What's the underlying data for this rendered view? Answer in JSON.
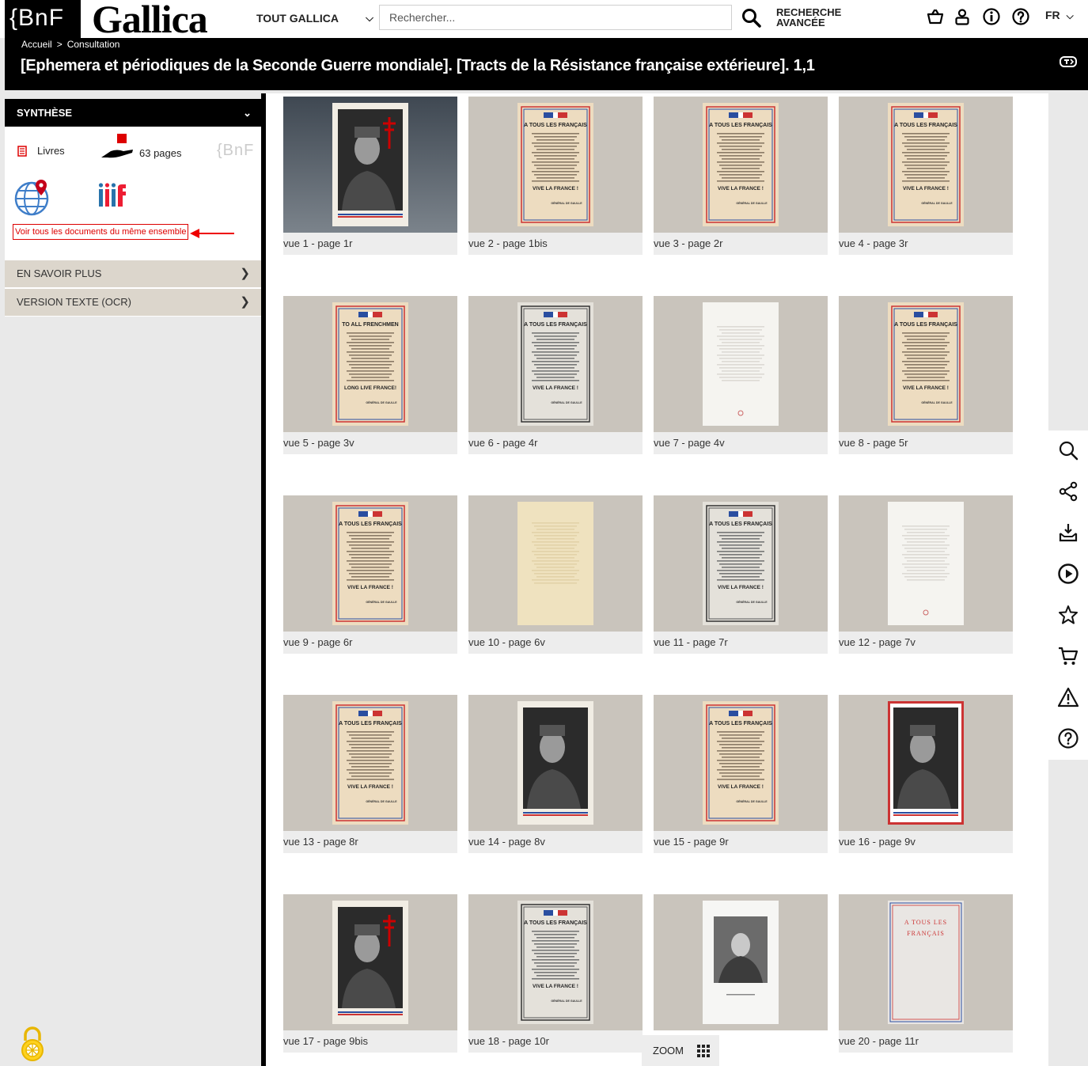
{
  "header": {
    "bnf_logo": "{BnF",
    "gallica_logo": "Gallica",
    "scope": "TOUT GALLICA",
    "search_placeholder": "Rechercher...",
    "advanced_line1": "RECHERCHE",
    "advanced_line2": "AVANCÉE",
    "lang": "FR",
    "icons": [
      "basket-icon",
      "account-icon",
      "info-icon",
      "help-icon"
    ]
  },
  "breadcrumb": {
    "home": "Accueil",
    "sep": ">",
    "current": "Consultation"
  },
  "title": "[Ephemera et périodiques de la Seconde Guerre mondiale]. [Tracts de la Résistance française extérieure]. 1,1",
  "sidebar": {
    "header": "SYNTHÈSE",
    "doc_type": "Livres",
    "pages": "63 pages",
    "watermark": "{BnF",
    "same_set_link": "Voir tous les documents du même ensemble",
    "panels": [
      {
        "label": "EN SAVOIR PLUS"
      },
      {
        "label": "VERSION TEXTE (OCR)"
      }
    ]
  },
  "thumbnails": [
    {
      "caption": "vue 1 - page 1r",
      "kind": "portrait-cross",
      "dark": true
    },
    {
      "caption": "vue 2 - page 1bis",
      "kind": "poster"
    },
    {
      "caption": "vue 3 - page 2r",
      "kind": "poster"
    },
    {
      "caption": "vue 4 - page 3r",
      "kind": "poster"
    },
    {
      "caption": "vue 5 - page 3v",
      "kind": "poster-en"
    },
    {
      "caption": "vue 6 - page 4r",
      "kind": "poster-bw"
    },
    {
      "caption": "vue 7 - page 4v",
      "kind": "blank"
    },
    {
      "caption": "vue 8 - page 5r",
      "kind": "poster"
    },
    {
      "caption": "vue 9 - page 6r",
      "kind": "poster"
    },
    {
      "caption": "vue 10 - page 6v",
      "kind": "faded"
    },
    {
      "caption": "vue 11 - page 7r",
      "kind": "poster-bw"
    },
    {
      "caption": "vue 12 - page 7v",
      "kind": "blank"
    },
    {
      "caption": "vue 13 - page 8r",
      "kind": "poster"
    },
    {
      "caption": "vue 14 - page 8v",
      "kind": "portrait"
    },
    {
      "caption": "vue 15 - page 9r",
      "kind": "poster"
    },
    {
      "caption": "vue 16 - page 9v",
      "kind": "portrait-frame"
    },
    {
      "caption": "vue 17 - page 9bis",
      "kind": "portrait-cross"
    },
    {
      "caption": "vue 18 - page 10r",
      "kind": "poster-bw"
    },
    {
      "caption": "",
      "kind": "engraving"
    },
    {
      "caption": "vue 20 - page 11r",
      "kind": "cover"
    }
  ],
  "poster_text": {
    "heading": "A TOUS LES FRANÇAIS",
    "heading_en": "TO ALL FRENCHMEN",
    "slogan": "VIVE LA FRANCE !",
    "slogan_en": "LONG LIVE FRANCE!",
    "signature": "GÉNÉRAL DE GAULLE",
    "cover_line1": "A TOUS LES",
    "cover_line2": "FRANÇAIS"
  },
  "zoom": {
    "label": "ZOOM"
  },
  "right_toolbar": [
    "search-icon",
    "share-icon",
    "download-icon",
    "play-icon",
    "star-icon",
    "cart-icon",
    "warning-icon",
    "help-icon"
  ],
  "colors": {
    "accent_red": "#d00000",
    "poster_paper": "#eddcc0",
    "panel_beige": "#dcd6cc"
  }
}
